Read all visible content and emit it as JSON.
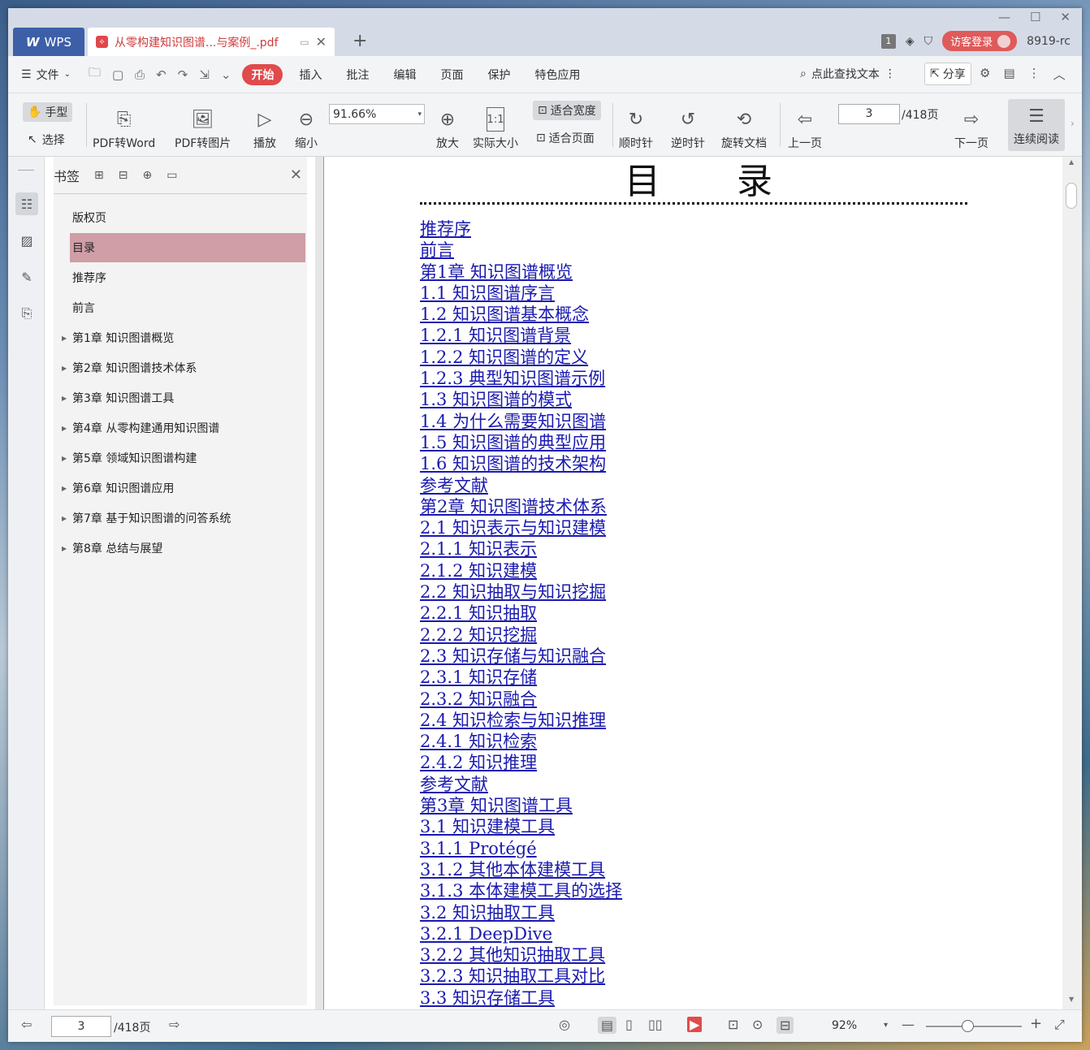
{
  "tabs": {
    "app_label": "WPS",
    "doc_title": "从零构建知识图谱...与案例_.pdf"
  },
  "titlebar": {
    "badge": "1",
    "guest_login": "访客登录",
    "user_id": "8919-rc"
  },
  "menu": {
    "file": "文件",
    "start": "开始",
    "items": [
      "插入",
      "批注",
      "编辑",
      "页面",
      "保护",
      "特色应用"
    ],
    "search": "点此查找文本",
    "share": "分享"
  },
  "toolbar": {
    "hand": "手型",
    "select": "选择",
    "pdf2word": "PDF转Word",
    "pdf2img": "PDF转图片",
    "play": "播放",
    "zoom_out": "缩小",
    "zoom_value": "91.66%",
    "zoom_in": "放大",
    "actual_size": "实际大小",
    "fit_width": "适合宽度",
    "fit_page": "适合页面",
    "clockwise": "顺时针",
    "counterclockwise": "逆时针",
    "rotate_doc": "旋转文档",
    "prev_page": "上一页",
    "page_input": "3",
    "page_total": "/418页",
    "next_page": "下一页",
    "continuous": "连续阅读"
  },
  "bookmarks": {
    "title": "书签",
    "items": [
      {
        "label": "版权页",
        "expandable": false,
        "selected": false
      },
      {
        "label": "目录",
        "expandable": false,
        "selected": true
      },
      {
        "label": "推荐序",
        "expandable": false,
        "selected": false
      },
      {
        "label": "前言",
        "expandable": false,
        "selected": false
      },
      {
        "label": "第1章 知识图谱概览",
        "expandable": true,
        "selected": false
      },
      {
        "label": "第2章 知识图谱技术体系",
        "expandable": true,
        "selected": false
      },
      {
        "label": "第3章 知识图谱工具",
        "expandable": true,
        "selected": false
      },
      {
        "label": "第4章 从零构建通用知识图谱",
        "expandable": true,
        "selected": false
      },
      {
        "label": "第5章 领域知识图谱构建",
        "expandable": true,
        "selected": false
      },
      {
        "label": "第6章 知识图谱应用",
        "expandable": true,
        "selected": false
      },
      {
        "label": "第7章 基于知识图谱的问答系统",
        "expandable": true,
        "selected": false
      },
      {
        "label": "第8章 总结与展望",
        "expandable": true,
        "selected": false
      }
    ]
  },
  "document": {
    "heading": "目 录",
    "toc": [
      "推荐序",
      "前言",
      "第1章 知识图谱概览",
      "1.1 知识图谱序言",
      "1.2 知识图谱基本概念",
      "1.2.1 知识图谱背景",
      "1.2.2 知识图谱的定义",
      "1.2.3 典型知识图谱示例",
      "1.3 知识图谱的模式",
      "1.4 为什么需要知识图谱",
      "1.5 知识图谱的典型应用",
      "1.6 知识图谱的技术架构",
      "参考文献",
      "第2章 知识图谱技术体系",
      "2.1 知识表示与知识建模",
      "2.1.1 知识表示",
      "2.1.2 知识建模",
      "2.2 知识抽取与知识挖掘",
      "2.2.1 知识抽取",
      "2.2.2 知识挖掘",
      "2.3 知识存储与知识融合",
      "2.3.1 知识存储",
      "2.3.2 知识融合",
      "2.4 知识检索与知识推理",
      "2.4.1 知识检索",
      "2.4.2 知识推理",
      "参考文献",
      "第3章 知识图谱工具",
      "3.1 知识建模工具",
      "3.1.1 Protégé",
      "3.1.2 其他本体建模工具",
      "3.1.3 本体建模工具的选择",
      "3.2 知识抽取工具",
      "3.2.1 DeepDive",
      "3.2.2 其他知识抽取工具",
      "3.2.3 知识抽取工具对比",
      "3.3 知识存储工具"
    ]
  },
  "status": {
    "page_input": "3",
    "page_total": "/418页",
    "zoom": "92%"
  },
  "colors": {
    "accent": "#e04b4b",
    "link": "#1a1ab0",
    "selected_bookmark": "#cf9ea6"
  }
}
